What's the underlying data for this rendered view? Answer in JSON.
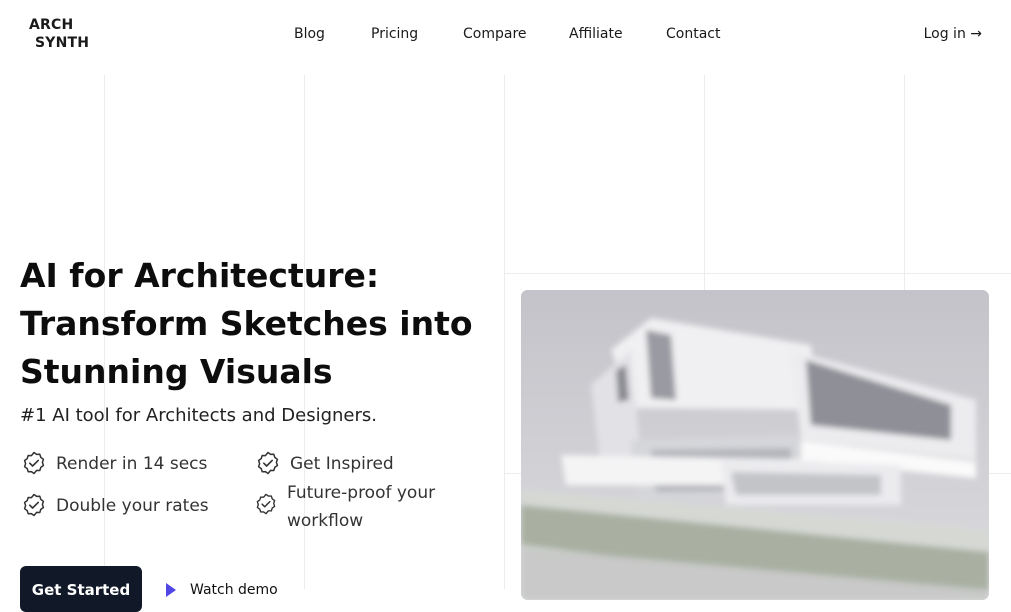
{
  "brand": {
    "line1": "ARCH",
    "line2": "SYNTH"
  },
  "nav": {
    "items": [
      {
        "label": "Blog"
      },
      {
        "label": "Pricing"
      },
      {
        "label": "Compare"
      },
      {
        "label": "Affiliate"
      },
      {
        "label": "Contact"
      }
    ],
    "login_label": "Log in →"
  },
  "hero": {
    "title": "AI for Architecture: Transform Sketches into Stunning Visuals",
    "subtitle": "#1 AI tool for Architects and Designers.",
    "features": [
      {
        "label": "Render in 14 secs",
        "icon": "check-circle-icon"
      },
      {
        "label": "Get Inspired",
        "icon": "check-circle-icon"
      },
      {
        "label": "Double your rates",
        "icon": "check-circle-icon"
      },
      {
        "label": "Future-proof your workflow",
        "icon": "check-circle-icon"
      }
    ],
    "cta_label": "Get Started",
    "watch_label": "Watch demo",
    "accent_color": "#4f46e5",
    "cta_color": "#111827"
  }
}
